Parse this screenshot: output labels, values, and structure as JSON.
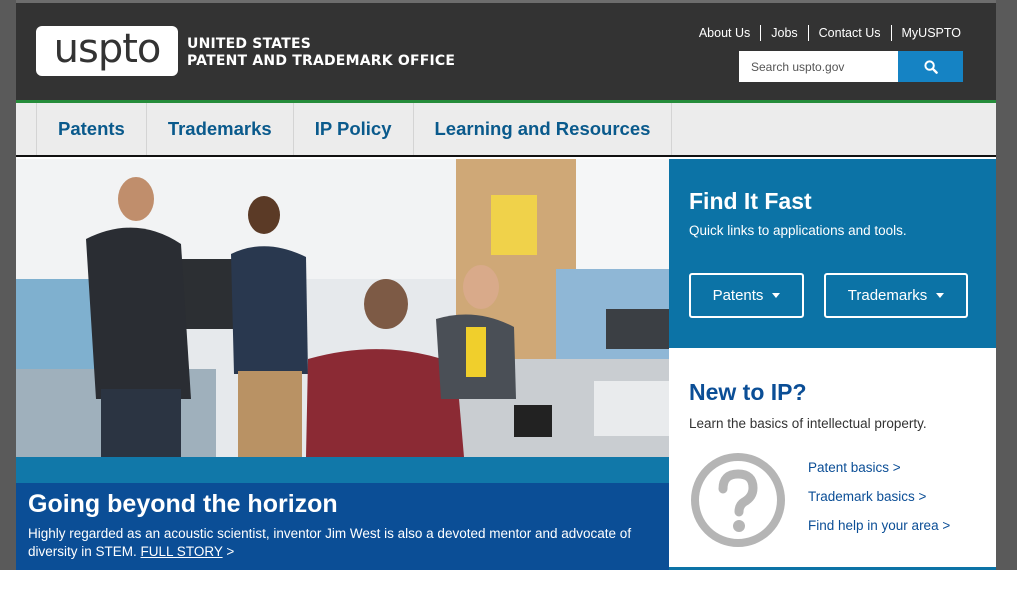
{
  "header": {
    "logo_text": "uspto",
    "agency_line1": "UNITED STATES",
    "agency_line2": "PATENT AND TRADEMARK OFFICE",
    "utility_links": [
      "About Us",
      "Jobs",
      "Contact Us",
      "MyUSPTO"
    ],
    "search": {
      "placeholder": "Search uspto.gov",
      "button_icon": "search-icon"
    }
  },
  "nav": {
    "items": [
      "Patents",
      "Trademarks",
      "IP Policy",
      "Learning and Resources"
    ]
  },
  "hero": {
    "title": "Going beyond the horizon",
    "description": "Highly regarded as an acoustic scientist, inventor Jim West is also a devoted mentor and advocate of diversity in STEM.",
    "link_label": "FULL STORY",
    "link_suffix": ">"
  },
  "find_it_fast": {
    "title": "Find It Fast",
    "subtitle": "Quick links to applications and tools.",
    "buttons": [
      "Patents",
      "Trademarks"
    ]
  },
  "new_to_ip": {
    "title": "New to IP?",
    "subtitle": "Learn the basics of intellectual property.",
    "icon": "question-circle-icon",
    "links": [
      "Patent basics >",
      "Trademark basics >",
      "Find help in your area >"
    ]
  },
  "colors": {
    "header_bg": "#333333",
    "accent_blue": "#1583c4",
    "nav_text": "#0a5a8c",
    "find_fast_bg": "#0c73a6",
    "hero_caption_bg": "#0b4e96",
    "green_rule": "#258c3a"
  }
}
